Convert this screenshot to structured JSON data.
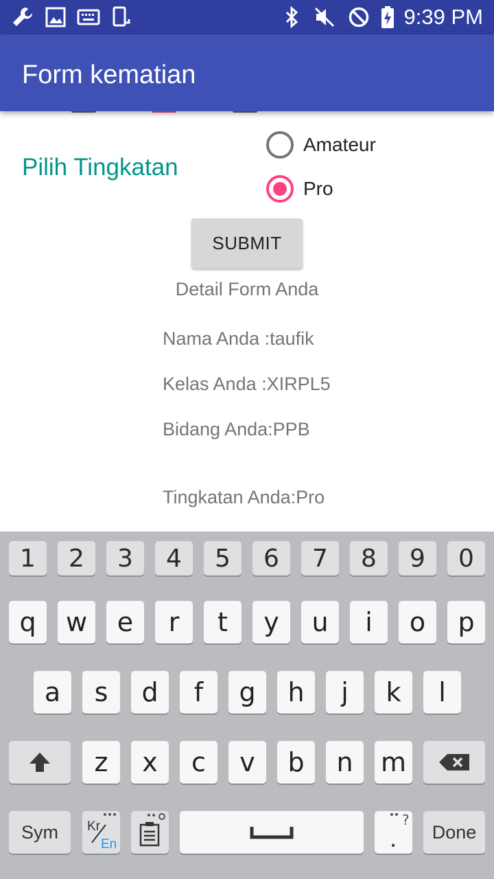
{
  "status_bar": {
    "time": "9:39 PM",
    "left_icons": [
      "wrench-icon",
      "image-icon",
      "keyboard-icon",
      "phone-rotate-icon"
    ],
    "right_icons": [
      "bluetooth-icon",
      "mute-icon",
      "do-not-disturb-icon",
      "battery-charging-icon"
    ]
  },
  "app_bar": {
    "title": "Form kematian"
  },
  "form": {
    "level_label": "Pilih Tingkatan",
    "options": [
      {
        "label": "Amateur",
        "checked": false
      },
      {
        "label": "Pro",
        "checked": true
      }
    ],
    "submit_label": "SUBMIT"
  },
  "details": {
    "title": "Detail Form Anda",
    "name": "Nama Anda :taufik",
    "class": "Kelas Anda :XIRPL5",
    "field": "Bidang Anda:PPB",
    "level": "Tingkatan Anda:Pro"
  },
  "keyboard": {
    "row_numbers": [
      "1",
      "2",
      "3",
      "4",
      "5",
      "6",
      "7",
      "8",
      "9",
      "0"
    ],
    "row1": [
      "q",
      "w",
      "e",
      "r",
      "t",
      "y",
      "u",
      "i",
      "o",
      "p"
    ],
    "row2": [
      "a",
      "s",
      "d",
      "f",
      "g",
      "h",
      "j",
      "k",
      "l"
    ],
    "row3": [
      "z",
      "x",
      "c",
      "v",
      "b",
      "n",
      "m"
    ],
    "sym_label": "Sym",
    "lang_primary": "Kr",
    "lang_secondary": "En",
    "done_label": "Done",
    "period": ".",
    "period_hint": "?",
    "colors": {
      "accent": "#2196f3",
      "background": "#babcc0"
    }
  },
  "colors": {
    "status_bar": "#303f9f",
    "app_bar": "#3f51b5",
    "label_teal": "#009688",
    "radio_accent": "#ff4081"
  }
}
